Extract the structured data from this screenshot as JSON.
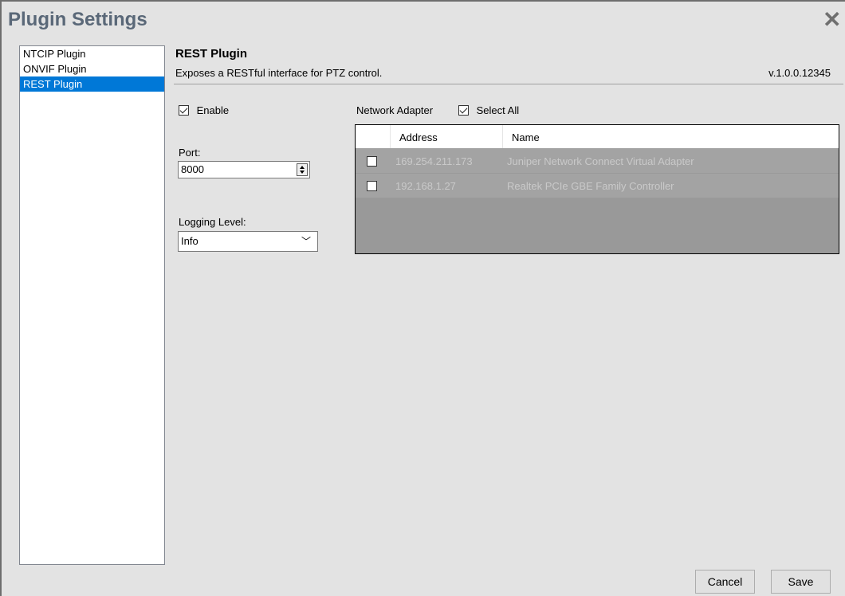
{
  "window": {
    "title": "Plugin Settings"
  },
  "sidebar": {
    "items": [
      {
        "label": "NTCIP Plugin",
        "selected": false
      },
      {
        "label": "ONVIF Plugin",
        "selected": false
      },
      {
        "label": "REST Plugin",
        "selected": true
      }
    ]
  },
  "header": {
    "title": "REST Plugin",
    "description": "Exposes a RESTful interface for PTZ control.",
    "version": "v.1.0.0.12345"
  },
  "settings": {
    "enable_label": "Enable",
    "enabled": true,
    "port_label": "Port:",
    "port_value": "8000",
    "logging_label": "Logging Level:",
    "logging_value": "Info"
  },
  "network": {
    "label": "Network Adapter",
    "select_all_label": "Select All",
    "select_all_checked": true,
    "columns": [
      "Address",
      "Name"
    ],
    "rows": [
      {
        "address": "169.254.211.173",
        "name": "Juniper Network Connect Virtual Adapter",
        "checked": false
      },
      {
        "address": "192.168.1.27",
        "name": "Realtek PCIe GBE Family Controller",
        "checked": false
      }
    ]
  },
  "buttons": {
    "cancel": "Cancel",
    "save": "Save"
  },
  "colors": {
    "selection": "#0078d7",
    "title": "#5a6878",
    "grid_disabled": "#a3a3a3"
  }
}
